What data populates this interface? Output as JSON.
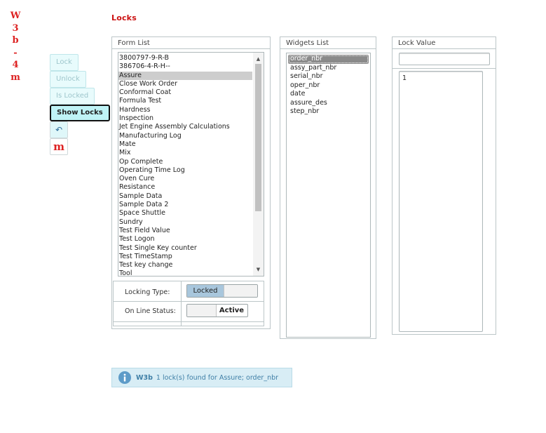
{
  "logo": {
    "letters": [
      "W",
      "3",
      "b",
      "-",
      "4",
      "m"
    ]
  },
  "sidebar": {
    "buttons": [
      {
        "label": "Lock"
      },
      {
        "label": "Unlock"
      },
      {
        "label": "Is Locked"
      },
      {
        "label": "Show Locks"
      }
    ],
    "icons": [
      {
        "name": "undo-icon",
        "glyph": "↶"
      },
      {
        "name": "m-logo-icon",
        "glyph": "m"
      }
    ]
  },
  "page": {
    "title": "Locks"
  },
  "form_list": {
    "header": "Form List",
    "items": [
      "3800797-9-R-B",
      "386706-4-R-H--",
      "Assure",
      "Close Work Order",
      "Conformal Coat",
      "Formula Test",
      "Hardness",
      "Inspection",
      "Jet Engine Assembly Calculations",
      "Manufacturing Log",
      "Mate",
      "Mix",
      "Op Complete",
      "Operating Time Log",
      "Oven Cure",
      "Resistance",
      "Sample Data",
      "Sample Data 2",
      "Space Shuttle",
      "Sundry",
      "Test Field Value",
      "Test Logon",
      "Test Single Key counter",
      "Test TimeStamp",
      "Test key change",
      "Tool"
    ],
    "selected": "Assure"
  },
  "options": {
    "locking_type_label": "Locking Type:",
    "locking_type_value": "Locked",
    "online_status_label": "On Line Status:",
    "online_status_value": "Active"
  },
  "widgets_list": {
    "header": "Widgets List",
    "items": [
      "order_nbr",
      "assy_part_nbr",
      "serial_nbr",
      "oper_nbr",
      "date",
      "assure_des",
      "step_nbr"
    ],
    "selected": "order_nbr"
  },
  "lock_value": {
    "header": "Lock Value",
    "input_value": "",
    "values": [
      "1"
    ]
  },
  "status": {
    "brand": "W3b",
    "count": "1",
    "message": "lock(s) found for Assure; order_nbr"
  }
}
